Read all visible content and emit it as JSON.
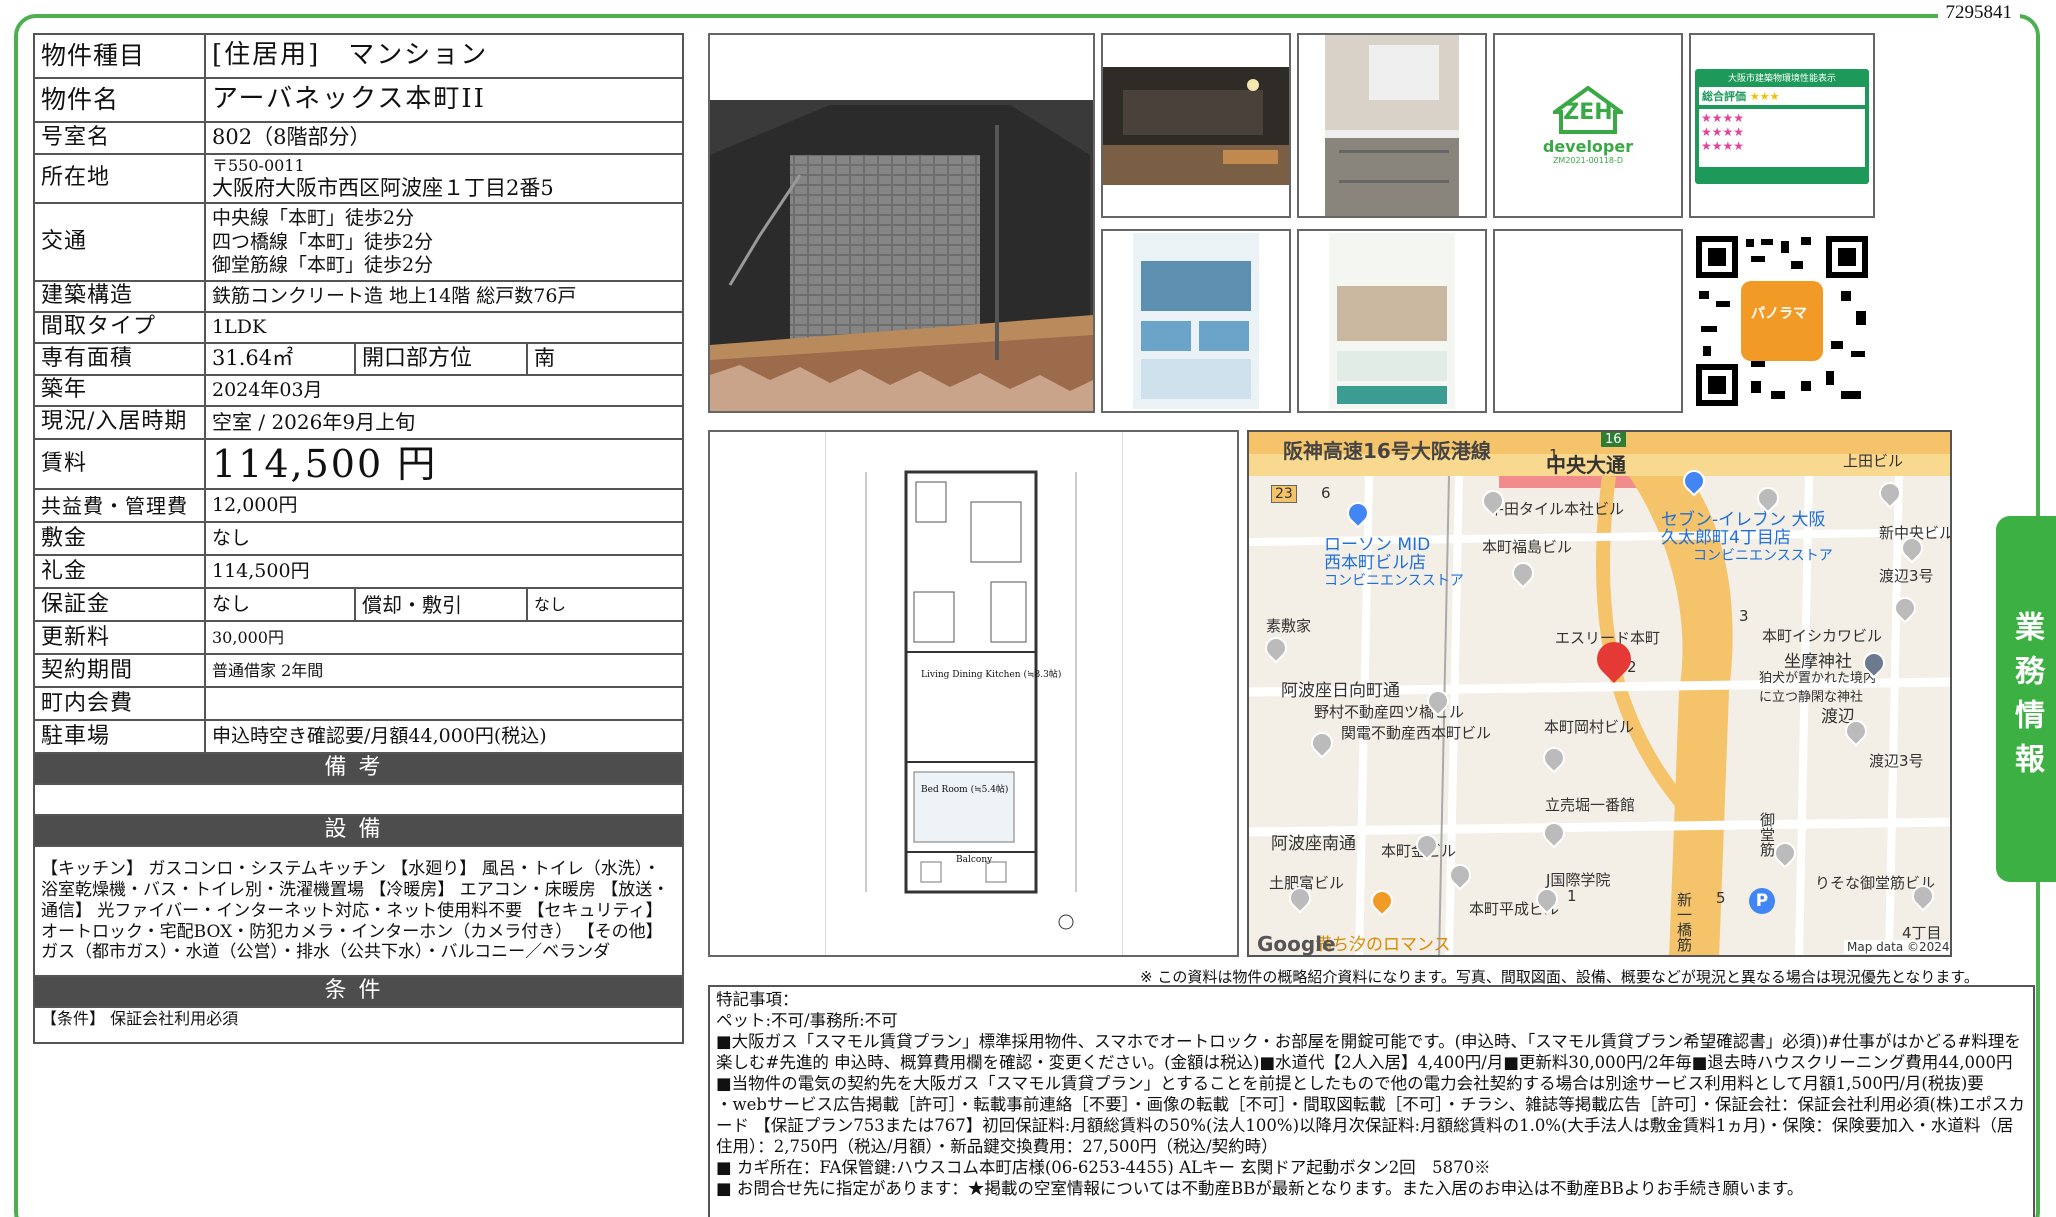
{
  "doc_id": "7295841",
  "spec": {
    "type_label": "物件種目",
    "type_value": "[住居用]　マンション",
    "name_label": "物件名",
    "name_value": "アーバネックス本町II",
    "room_label": "号室名",
    "room_value": "802（8階部分）",
    "addr_label": "所在地",
    "addr_zip": "〒550-0011",
    "addr_value": "大阪府大阪市西区阿波座１丁目2番5",
    "transit_label": "交通",
    "transit_1": "中央線「本町」徒歩2分",
    "transit_2": "四つ橋線「本町」徒歩2分",
    "transit_3": "御堂筋線「本町」徒歩2分",
    "struct_label": "建築構造",
    "struct_value": "鉄筋コンクリート造 地上14階 総戸数76戸",
    "layout_label": "間取タイプ",
    "layout_value": "1LDK",
    "area_label": "専有面積",
    "area_value": "31.64㎡",
    "facing_label": "開口部方位",
    "facing_value": "南",
    "built_label": "築年",
    "built_value": "2024年03月",
    "status_label": "現況/入居時期",
    "status_value": "空室 / 2026年9月上旬",
    "rent_label": "賃料",
    "rent_value": "114,500 円",
    "fee_label": "共益費・管理費",
    "fee_value": "12,000円",
    "deposit_label": "敷金",
    "deposit_value": "なし",
    "key_label": "礼金",
    "key_value": "114,500円",
    "guarantee_label": "保証金",
    "guarantee_value": "なし",
    "amort_label": "償却・敷引",
    "amort_value": "なし",
    "renew_label": "更新料",
    "renew_value": "30,000円",
    "contract_label": "契約期間",
    "contract_value": "普通借家 2年間",
    "assoc_label": "町内会費",
    "assoc_value": "",
    "parking_label": "駐車場",
    "parking_value": "申込時空き確認要/月額44,000円(税込)",
    "remarks_header": "備考",
    "remarks_value": "",
    "equip_header": "設備",
    "equip_value": "【キッチン】 ガスコンロ・システムキッチン 【水廻り】 風呂・トイレ（水洗）・浴室乾燥機・バス・トイレ別・洗濯機置場 【冷暖房】 エアコン・床暖房 【放送・通信】 光ファイバー・インターネット対応・ネット使用料不要 【セキュリティ】 オートロック・宅配BOX・防犯カメラ・インターホン（カメラ付き） 【その他】 ガス（都市ガス）・水道（公営）・排水（公共下水）・バルコニー／ベランダ",
    "cond_header": "条件",
    "cond_value": "【条件】 保証会社利用必須"
  },
  "images": {
    "zeh_text": "ZEH",
    "zeh_sub": "developer",
    "zeh_code": "ZM2021-00118-D",
    "label_title": "大阪市建築物環境性能表示",
    "label_rating": "総合評価",
    "qr_label": "パノラマ",
    "floor_ldk": "Living Dining Kitchen (≒8.3帖)",
    "floor_bed": "Bed Room (≒5.4帖)",
    "floor_bal": "Balcony"
  },
  "map": {
    "road1": "阪神高速16号大阪港線",
    "road2": "中央大通",
    "route16": "16",
    "route23": "23",
    "lawson": "ローソン MID\n西本町ビル店",
    "lawson_sub": "コンビニエンスストア",
    "seven": "セブン-イレブン 大阪\n久太郎町4丁目店",
    "seven_sub": "コンビニエンスストア",
    "p1": "平田タイル本社ビル",
    "p2": "本町福島ビル",
    "p3": "上田ビル",
    "p4": "新中央ビル",
    "p5": "渡辺3号",
    "p6": "素敷家",
    "p7": "エスリード本町",
    "p8": "本町イシカワビル",
    "p9": "坐摩神社",
    "p10": "狛犬が置かれた境内\nに立つ静閑な神社",
    "p11": "阿波座日向町通",
    "p12": "野村不動産四ツ橋ビル",
    "p13": "関電不動産西本町ビル",
    "p14": "本町岡村ビル",
    "p15": "渡辺",
    "p16": "渡辺3号",
    "p17": "立売堀一番館",
    "p18": "阿波座南通",
    "p19": "本町金ビル",
    "p20": "土肥富ビル",
    "p21": "J国際学院",
    "p22": "本町平成ビル",
    "p23": "りそな御堂筋ビル",
    "p24": "満ち汐のロマンス",
    "p25": "4丁目",
    "p26": "御堂筋",
    "p27": "新一橋筋",
    "n1": "1",
    "n2": "2",
    "n3": "3",
    "n5": "5",
    "n6": "6",
    "n1b": "1",
    "google": "Google",
    "mapdata": "Map data ©2024"
  },
  "note": "※ この資料は物件の概略紹介資料になります。写真、間取図面、設備、概要などが現況と異なる場合は現況優先となります。",
  "remarks": {
    "l1": "特記事項：",
    "l2": "ペット:不可/事務所:不可",
    "l3": "■大阪ガス「スマモル賃貸プラン」標準採用物件、スマホでオートロック・お部屋を開錠可能です。(申込時、「スマモル賃貸プラン希望確認書」必須))#仕事がはかどる#料理を楽しむ#先進的 申込時、概算費用欄を確認・変更ください。(金額は税込)■水道代【2人入居】4,400円/月■更新料30,000円/2年毎■退去時ハウスクリーニング費用44,000円 ■当物件の電気の契約先を大阪ガス「スマモル賃貸プラン」とすることを前提としたもので他の電力会社契約する場合は別途サービス利用料として月額1,500円/月(税抜)要",
    "l4": "・webサービス広告掲載［許可］・転載事前連絡［不要］・画像の転載［不可］・間取図転載［不可］・チラシ、雑誌等掲載広告［許可］・保証会社：保証会社利用必須(株)エポスカード 【保証プラン753または767】初回保証料:月額総賃料の50%(法人100%)以降月次保証料:月額総賃料の1.0%(大手法人は敷金賃料1ヵ月)・保険：保険要加入・水道料（居住用）：2,750円（税込/月額）・新品鍵交換費用：27,500円（税込/契約時）",
    "l5": "■ カギ所在：FA保管鍵:ハウスコム本町店様(06-6253-4455) ALキー 玄関ドア起動ボタン2回　5870※",
    "l6": "■ お問合せ先に指定があります：★掲載の空室情報については不動産BBが最新となります。また入居のお申込は不動産BBよりお手続き願います。"
  },
  "side_tab": "業務情報"
}
